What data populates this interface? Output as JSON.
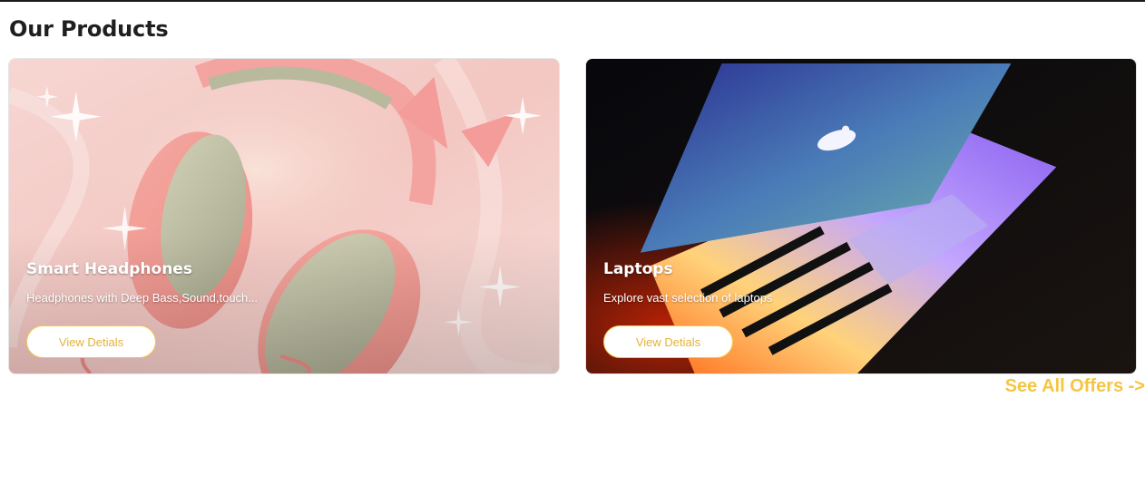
{
  "section": {
    "title": "Our Products"
  },
  "products": [
    {
      "title": "Smart Headphones",
      "description": "Headphones with Deep Bass,Sound,touch...",
      "button_label": "View Detials",
      "image_icon": "pink-cat-ear-headphones-image"
    },
    {
      "title": "Laptops",
      "description": "Explore vast selection of laptops",
      "button_label": "View Detials",
      "image_icon": "rainbow-lit-laptop-image"
    }
  ],
  "footer_link": {
    "label": "See All Offers ->"
  },
  "colors": {
    "accent": "#f5c542",
    "button_border": "#f2c94c",
    "title_text": "#1f1f1f"
  }
}
